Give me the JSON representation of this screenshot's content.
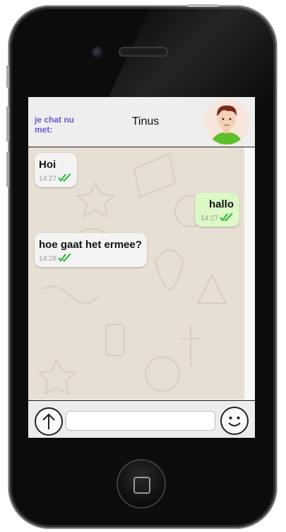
{
  "header": {
    "label": "je chat nu met:",
    "contact_name": "Tinus",
    "avatar_icon": "person-avatar-icon"
  },
  "messages": [
    {
      "direction": "in",
      "text": "Hoi",
      "time": "14:27",
      "status": "read"
    },
    {
      "direction": "out",
      "text": "hallo",
      "time": "14:27",
      "status": "read"
    },
    {
      "direction": "in",
      "text": "hoe gaat het ermee?",
      "time": "14:28",
      "status": "read"
    }
  ],
  "composer": {
    "input_value": "",
    "upload_icon": "arrow-up-circle-icon",
    "emoji_icon": "smiley-icon"
  },
  "colors": {
    "incoming_bubble": "#f3f3f3",
    "outgoing_bubble": "#dcf8c6",
    "read_ticks": "#27b53d",
    "header_label": "#6a5acd",
    "chat_background": "#e7dfd3"
  }
}
